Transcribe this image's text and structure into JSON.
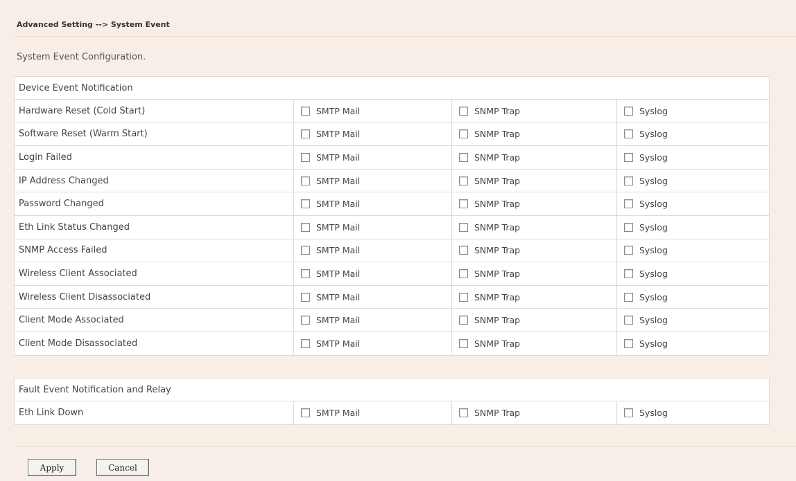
{
  "breadcrumb": "Advanced Setting --> System Event",
  "subtitle": "System Event Configuration.",
  "device_section": {
    "title": "Device Event Notification",
    "rows": [
      {
        "label": "Hardware Reset (Cold Start)",
        "smtp": false,
        "snmp": false,
        "syslog": false
      },
      {
        "label": "Software Reset (Warm Start)",
        "smtp": false,
        "snmp": false,
        "syslog": false
      },
      {
        "label": "Login Failed",
        "smtp": false,
        "snmp": false,
        "syslog": false
      },
      {
        "label": "IP Address Changed",
        "smtp": false,
        "snmp": false,
        "syslog": false
      },
      {
        "label": "Password Changed",
        "smtp": false,
        "snmp": false,
        "syslog": false
      },
      {
        "label": "Eth Link Status Changed",
        "smtp": false,
        "snmp": false,
        "syslog": false
      },
      {
        "label": "SNMP Access Failed",
        "smtp": false,
        "snmp": false,
        "syslog": false
      },
      {
        "label": "Wireless Client Associated",
        "smtp": false,
        "snmp": false,
        "syslog": false
      },
      {
        "label": "Wireless Client Disassociated",
        "smtp": false,
        "snmp": false,
        "syslog": false
      },
      {
        "label": "Client Mode Associated",
        "smtp": false,
        "snmp": false,
        "syslog": false
      },
      {
        "label": "Client Mode Disassociated",
        "smtp": false,
        "snmp": false,
        "syslog": false
      }
    ]
  },
  "fault_section": {
    "title": "Fault Event Notification and Relay",
    "rows": [
      {
        "label": "Eth Link Down",
        "smtp": false,
        "snmp": false,
        "syslog": false
      }
    ]
  },
  "option_labels": {
    "smtp": "SMTP Mail",
    "snmp": "SNMP Trap",
    "syslog": "Syslog"
  },
  "buttons": {
    "apply": "Apply",
    "cancel": "Cancel"
  }
}
